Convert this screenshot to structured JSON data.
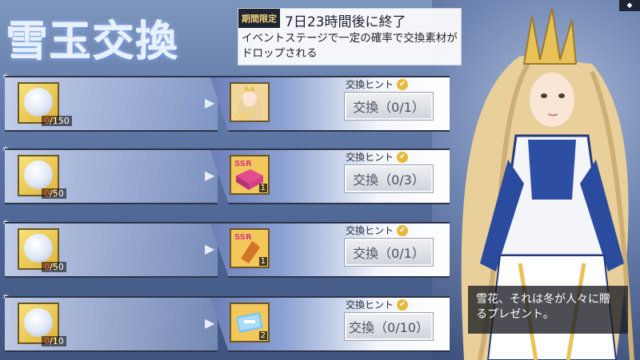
{
  "screen": {
    "title": "雪玉交換",
    "limited_tag": "期間限定",
    "countdown": "7日23時間後に終了",
    "description": "イベントステージで一定の確率で交換素材がドロップされる"
  },
  "rows": [
    {
      "count_current": "0",
      "count_total": "/150",
      "hint": "交換ヒント",
      "button": "交換（0/1）",
      "reward_type": "character-portrait",
      "reward_badge": ""
    },
    {
      "count_current": "0",
      "count_total": "/50",
      "hint": "交換ヒント",
      "button": "交換（0/3）",
      "reward_type": "ssr-box",
      "reward_badge": "1"
    },
    {
      "count_current": "0",
      "count_total": "/50",
      "hint": "交換ヒント",
      "button": "交換（0/1）",
      "reward_type": "ssr-crystal",
      "reward_badge": "1"
    },
    {
      "count_current": "0",
      "count_total": "/10",
      "hint": "交換ヒント",
      "button": "交換（0/10）",
      "reward_type": "ticket",
      "reward_badge": "2"
    }
  ],
  "dialog": {
    "text": "雪花、それは冬が人々に贈るプレゼント。"
  },
  "colors": {
    "count_zero": "#ff5a4a",
    "hint_check": "#e6b93a",
    "accent_gold": "#e3a93a"
  },
  "icons": {
    "snow_material": "snowball-icon",
    "arrow": "arrow-right-icon",
    "check": "check-circle-icon"
  }
}
